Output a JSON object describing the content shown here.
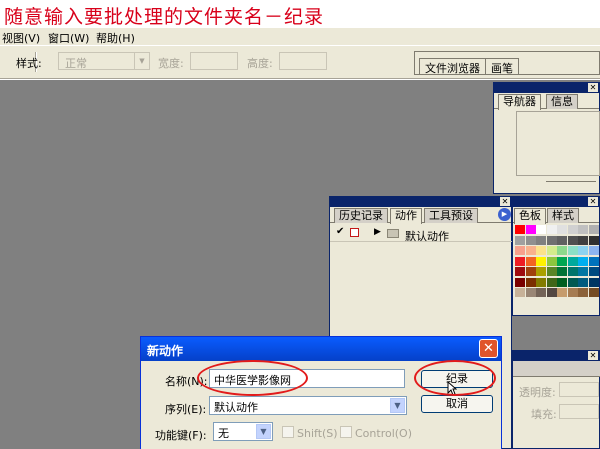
{
  "caption": "随意输入要批处理的文件夹名－纪录",
  "menu": [
    "视图(V)",
    "窗口(W)",
    "帮助(H)"
  ],
  "options": {
    "style_label": "样式:",
    "style_value": "正常",
    "width_label": "宽度:",
    "height_label": "高度:"
  },
  "well_tabs": [
    "文件浏览器",
    "画笔"
  ],
  "navigator": {
    "tabs": [
      "导航器",
      "信息"
    ]
  },
  "actions": {
    "tabs": [
      "历史记录",
      "动作",
      "工具预设"
    ],
    "item": "默认动作"
  },
  "swatches_panel": {
    "tabs": [
      "色板",
      "样式"
    ],
    "colors": [
      "#ff0000",
      "#ff00ff",
      "#ffffff",
      "#f0f0f0",
      "#e0e0e0",
      "#d0d0d0",
      "#c0c0c0",
      "#b0b0b0",
      "#a0a0a0",
      "#909090",
      "#808080",
      "#707070",
      "#606060",
      "#505050",
      "#404040",
      "#303030",
      "#f7a08c",
      "#f9b18c",
      "#fbe28c",
      "#d4ec8c",
      "#8cd98c",
      "#8ce0c6",
      "#8cd3f0",
      "#8cb4f0",
      "#ed1c24",
      "#f26522",
      "#fff200",
      "#8dc63f",
      "#00a651",
      "#00a99d",
      "#00aeef",
      "#0072bc",
      "#9e0b0f",
      "#a0410d",
      "#aba000",
      "#598527",
      "#007236",
      "#00746b",
      "#0076a3",
      "#004a80",
      "#790000",
      "#7b2e00",
      "#827b00",
      "#406618",
      "#005e20",
      "#005952",
      "#005b7f",
      "#003663",
      "#c7b299",
      "#998675",
      "#736357",
      "#534741",
      "#c69c6d",
      "#a67c52",
      "#8c6239",
      "#754c24"
    ]
  },
  "layers_panel": {
    "opacity_label": "透明度:",
    "fill_label": "填充:"
  },
  "dialog": {
    "title": "新动作",
    "name_label": "名称(N):",
    "name_value": "中华医学影像网",
    "set_label": "序列(E):",
    "set_value": "默认动作",
    "fkey_label": "功能键(F):",
    "fkey_value": "无",
    "shift_label": "Shift(S)",
    "control_label": "Control(O)",
    "record_button": "纪录",
    "cancel_button": "取消"
  },
  "colors": {
    "annotation_red": "#e21b1b",
    "workspace_gray": "#808080",
    "xp_blue": "#0a5cff"
  }
}
